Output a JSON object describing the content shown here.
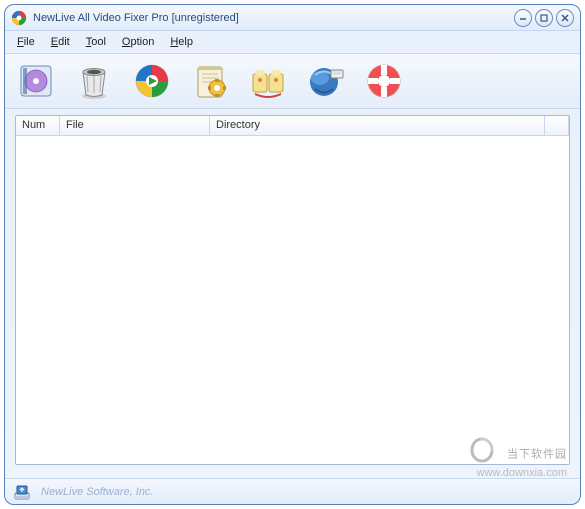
{
  "window": {
    "title": "NewLive All Video Fixer Pro  [unregistered]"
  },
  "menu": {
    "file": "File",
    "edit": "Edit",
    "tool": "Tool",
    "option": "Option",
    "help": "Help"
  },
  "toolbar": {
    "icons": [
      "add-files",
      "clear-list",
      "convert",
      "settings",
      "about",
      "update",
      "help"
    ]
  },
  "columns": {
    "num": "Num",
    "file": "File",
    "directory": "Directory"
  },
  "status": {
    "company": "NewLive Software, Inc."
  },
  "watermark": {
    "text": "当下软件园",
    "url": "www.downxia.com"
  }
}
